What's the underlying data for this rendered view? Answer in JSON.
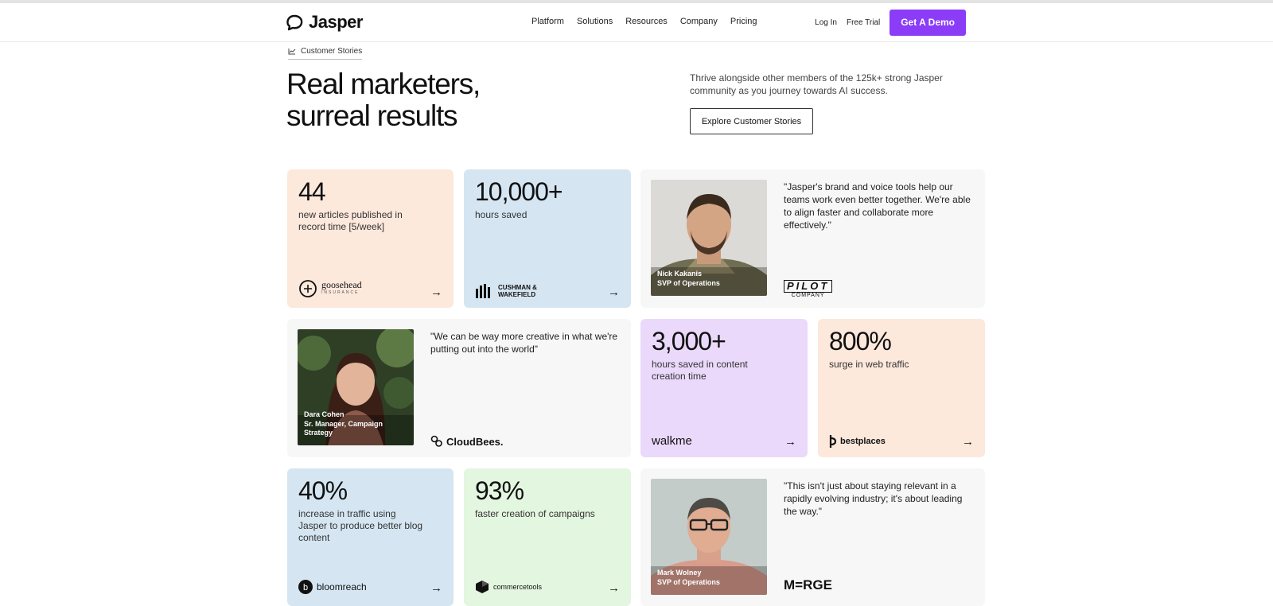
{
  "nav": {
    "logo": "Jasper",
    "menu": [
      "Platform",
      "Solutions",
      "Resources",
      "Company",
      "Pricing"
    ],
    "login": "Log In",
    "trial": "Free Trial",
    "demo": "Get A Demo"
  },
  "hero": {
    "eyebrow": "Customer Stories",
    "title_line1": "Real marketers,",
    "title_line2": "surreal results",
    "description": "Thrive alongside other members of the 125k+ strong Jasper community as you journey towards AI success.",
    "cta": "Explore Customer Stories"
  },
  "stats": [
    {
      "number": "44",
      "label": "new articles published in record time [5/week]",
      "brand": "goosehead",
      "brand_sub": "INSURANCE",
      "bg": "#fde8dc"
    },
    {
      "number": "10,000+",
      "label": "hours saved",
      "brand": "CUSHMAN & WAKEFIELD",
      "bg": "#d5e6f2"
    },
    {
      "number": "3,000+",
      "label": "hours saved in content creation time",
      "brand": "walkme",
      "bg": "#ead9fb"
    },
    {
      "number": "800%",
      "label": "surge in web traffic",
      "brand": "bestplaces",
      "bg": "#fde8dc"
    },
    {
      "number": "40%",
      "label": "increase in traffic using Jasper to produce better blog content",
      "brand": "bloomreach",
      "bg": "#d5e6f2"
    },
    {
      "number": "93%",
      "label": "faster creation of campaigns",
      "brand": "commercetools",
      "bg": "#e3f6df"
    }
  ],
  "testimonials": [
    {
      "quote": "\"Jasper's brand and voice tools help our teams work even better together. We're able to align faster and collaborate more effectively.\"",
      "name": "Nick Kakanis",
      "title": "SVP of Operations",
      "logo": "PILOT",
      "logo_sub": "COMPANY"
    },
    {
      "quote": "\"We can be way more creative in what we're putting out into the world\"",
      "name": "Dara Cohen",
      "title": "Sr. Manager, Campaign Strategy",
      "logo": "CloudBees."
    },
    {
      "quote": "\"This isn't just about staying relevant in a rapidly evolving industry; it's about leading the way.\"",
      "name": "Mark Wolney",
      "title": "SVP of Operations",
      "logo": "M=RGE"
    }
  ],
  "arrow": "→",
  "colors": {
    "accent": "#8b3cf7",
    "testimonial_bg": "#f7f7f7"
  },
  "icons": [
    "jasper-logo-icon",
    "chart-icon",
    "arrow-right-icon"
  ]
}
